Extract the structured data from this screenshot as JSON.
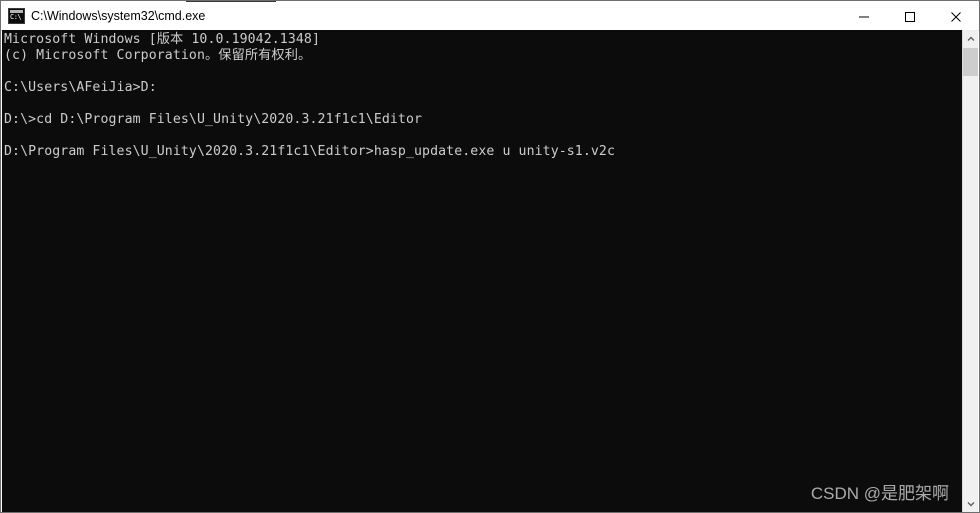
{
  "window": {
    "title": "C:\\Windows\\system32\\cmd.exe",
    "icon": "cmd-console-icon",
    "icon_glyph": "C:\\",
    "background_color": "#0c0c0c",
    "text_color": "#cccccc",
    "titlebar_color": "#ffffff"
  },
  "titlebar_buttons": {
    "minimize_label": "Minimize",
    "maximize_label": "Maximize",
    "close_label": "Close"
  },
  "console": {
    "lines": [
      "Microsoft Windows [版本 10.0.19042.1348]",
      "(c) Microsoft Corporation。保留所有权利。",
      "",
      "C:\\Users\\AFeiJia>D:",
      "",
      "D:\\>cd D:\\Program Files\\U_Unity\\2020.3.21f1c1\\Editor",
      "",
      "D:\\Program Files\\U_Unity\\2020.3.21f1c1\\Editor>hasp_update.exe u unity-s1.v2c"
    ],
    "text": "Microsoft Windows [版本 10.0.19042.1348]\n(c) Microsoft Corporation。保留所有权利。\n\nC:\\Users\\AFeiJia>D:\n\nD:\\>cd D:\\Program Files\\U_Unity\\2020.3.21f1c1\\Editor\n\nD:\\Program Files\\U_Unity\\2020.3.21f1c1\\Editor>hasp_update.exe u unity-s1.v2c"
  },
  "scrollbar": {
    "up_arrow": "chevron-up-icon",
    "down_arrow": "chevron-down-icon",
    "thumb_label": "scrollbar-thumb"
  },
  "watermark": {
    "text": "CSDN @是肥架啊"
  }
}
